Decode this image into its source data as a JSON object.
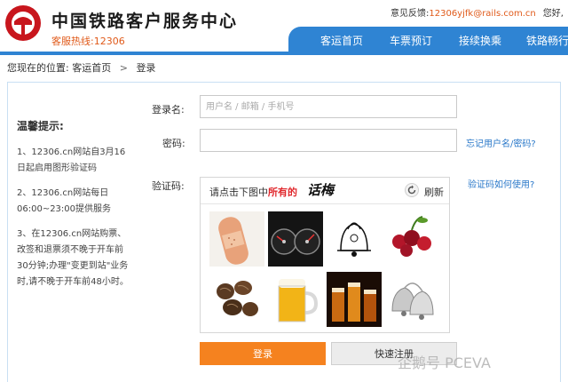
{
  "header": {
    "site_title": "中国铁路客户服务中心",
    "hotline": "客服热线:12306",
    "feedback_label": "意见反馈:",
    "feedback_email": "12306yjfk@rails.com.cn",
    "greeting": "您好,"
  },
  "nav": {
    "items": [
      {
        "label": "客运首页"
      },
      {
        "label": "车票预订"
      },
      {
        "label": "接续换乘"
      },
      {
        "label": "铁路畅行"
      }
    ]
  },
  "breadcrumb": {
    "prefix": "您现在的位置:",
    "home": "客运首页",
    "separator": ">",
    "current": "登录"
  },
  "tips": {
    "title": "温馨提示:",
    "items": [
      "1、12306.cn网站自3月16日起启用图形验证码",
      "2、12306.cn网站每日06:00~23:00提供服务",
      "3、在12306.cn网站购票、改签和退票须不晚于开车前30分钟;办理\"变更到站\"业务时,请不晚于开车前48小时。"
    ]
  },
  "form": {
    "username_label": "登录名:",
    "username_placeholder": "用户名 / 邮箱 / 手机号",
    "password_label": "密码:",
    "forgot_link": "忘记用户名/密码?",
    "captcha_label": "验证码:",
    "captcha_help_link": "验证码如何使用?"
  },
  "captcha": {
    "prompt_prefix": "请点击下图中",
    "prompt_highlight": "所有的",
    "target_word": "话梅",
    "refresh_label": "刷新",
    "tiles": [
      {
        "icon": "bandage-image"
      },
      {
        "icon": "speedometer-image"
      },
      {
        "icon": "bell-sketch-image"
      },
      {
        "icon": "cherries-image"
      },
      {
        "icon": "dried-plums-image"
      },
      {
        "icon": "beer-mug-image"
      },
      {
        "icon": "beer-glasses-image"
      },
      {
        "icon": "silver-bells-image"
      }
    ]
  },
  "buttons": {
    "login": "登录",
    "register": "快速注册"
  },
  "watermark": "企鹅号 PCEVA",
  "colors": {
    "brand_blue": "#2f84d3",
    "accent_orange": "#f5821f",
    "logo_red": "#c8161d",
    "highlight_red": "#e0262b",
    "link_blue": "#2a78c9"
  }
}
